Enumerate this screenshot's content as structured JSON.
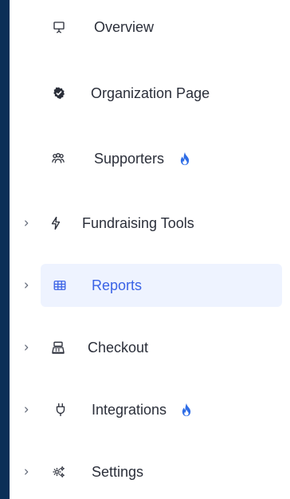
{
  "colors": {
    "rail": "#0b2f57",
    "text": "#2b2f3a",
    "active_text": "#3b63e6",
    "active_bg": "#eef3ff",
    "flame": "#2f6de6"
  },
  "sidebar": {
    "items": [
      {
        "label": "Overview",
        "icon": "presentation-icon",
        "has_chevron": false,
        "has_flame": false,
        "active": false
      },
      {
        "label": "Organization Page",
        "icon": "verified-badge-icon",
        "has_chevron": false,
        "has_flame": false,
        "active": false
      },
      {
        "label": "Supporters",
        "icon": "people-icon",
        "has_chevron": false,
        "has_flame": true,
        "active": false
      },
      {
        "label": "Fundraising Tools",
        "icon": "lightning-icon",
        "has_chevron": true,
        "has_flame": false,
        "active": false
      },
      {
        "label": "Reports",
        "icon": "table-icon",
        "has_chevron": true,
        "has_flame": false,
        "active": true
      },
      {
        "label": "Checkout",
        "icon": "cash-register-icon",
        "has_chevron": true,
        "has_flame": false,
        "active": false
      },
      {
        "label": "Integrations",
        "icon": "plug-icon",
        "has_chevron": true,
        "has_flame": true,
        "active": false
      },
      {
        "label": "Settings",
        "icon": "gears-icon",
        "has_chevron": true,
        "has_flame": false,
        "active": false
      }
    ]
  }
}
